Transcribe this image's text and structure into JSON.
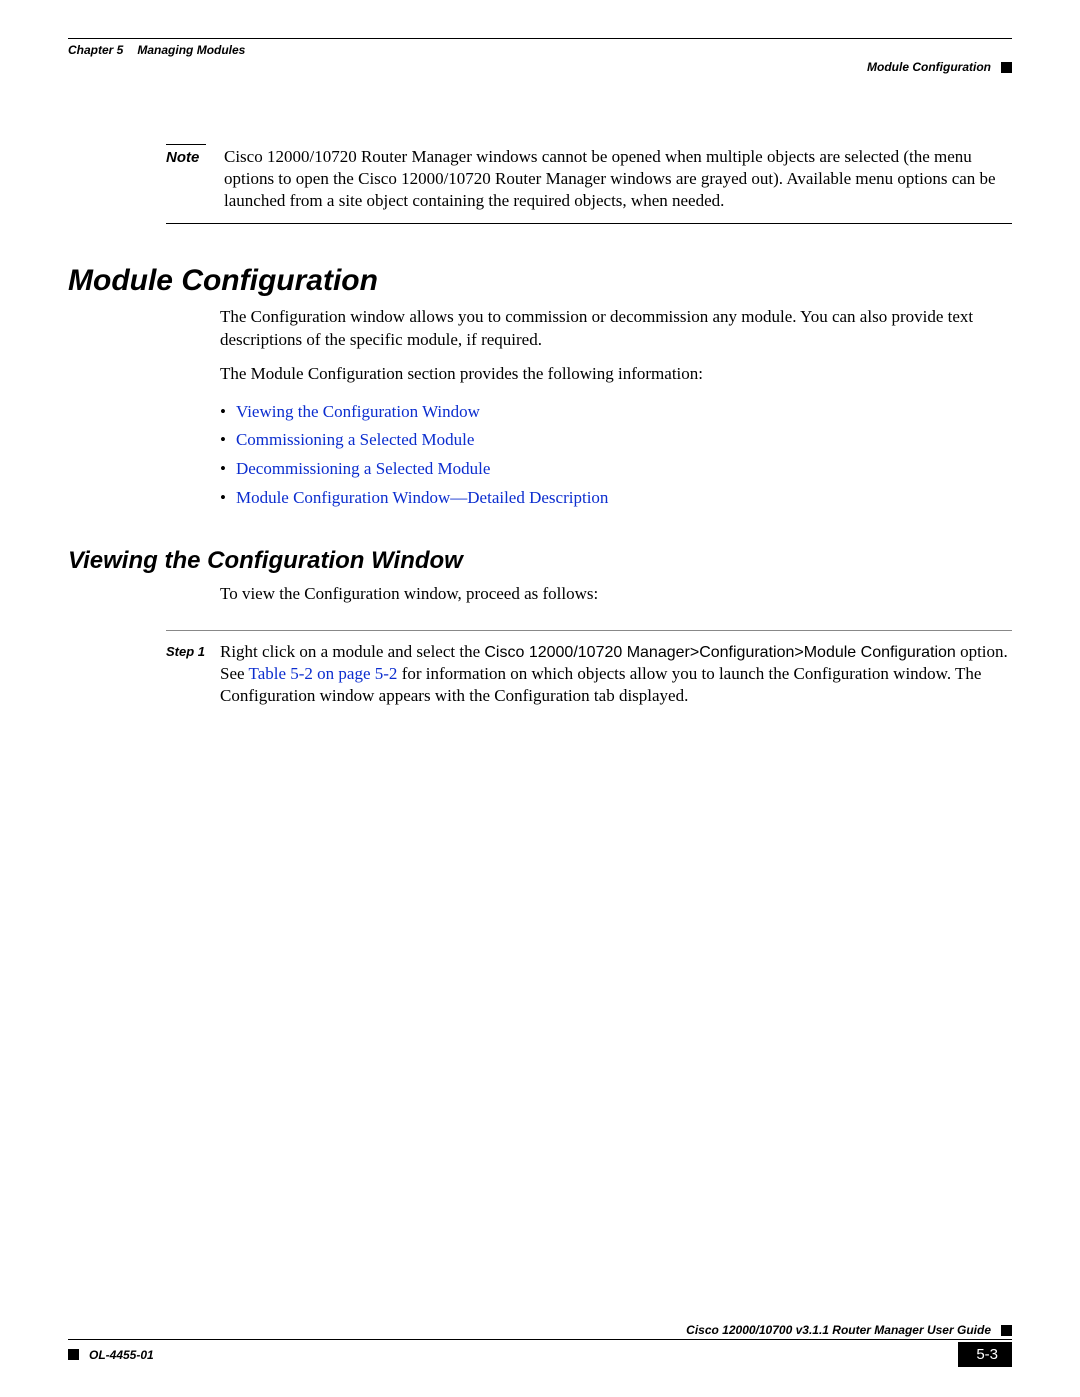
{
  "header": {
    "chapter_label": "Chapter 5",
    "chapter_title": "Managing Modules",
    "section": "Module Configuration"
  },
  "note": {
    "label": "Note",
    "text": "Cisco 12000/10720 Router Manager windows cannot be opened when multiple objects are selected (the menu options to open the Cisco 12000/10720 Router Manager windows are grayed out). Available menu options can be launched from a site object containing the required objects, when needed."
  },
  "h1": "Module Configuration",
  "intro1": "The Configuration window allows you to commission or decommission any module. You can also provide text descriptions of the specific module, if required.",
  "intro2": "The Module Configuration section provides the following information:",
  "links": [
    "Viewing the Configuration Window",
    "Commissioning a Selected Module",
    "Decommissioning a Selected Module",
    "Module Configuration Window—Detailed Description"
  ],
  "h2": "Viewing the Configuration Window",
  "view_intro": "To view the Configuration window, proceed as follows:",
  "step1": {
    "label": "Step 1",
    "pre": "Right click on a module and select the ",
    "path": "Cisco 12000/10720 Manager>Configuration>Module Configuration",
    "mid_a": " option. See ",
    "xref": "Table 5-2 on page 5-2",
    "post": " for information on which objects allow you to launch the Configuration window. The Configuration window appears with the Configuration tab displayed."
  },
  "footer": {
    "guide": "Cisco 12000/10700 v3.1.1 Router Manager User Guide",
    "docnum": "OL-4455-01",
    "page": "5-3"
  }
}
